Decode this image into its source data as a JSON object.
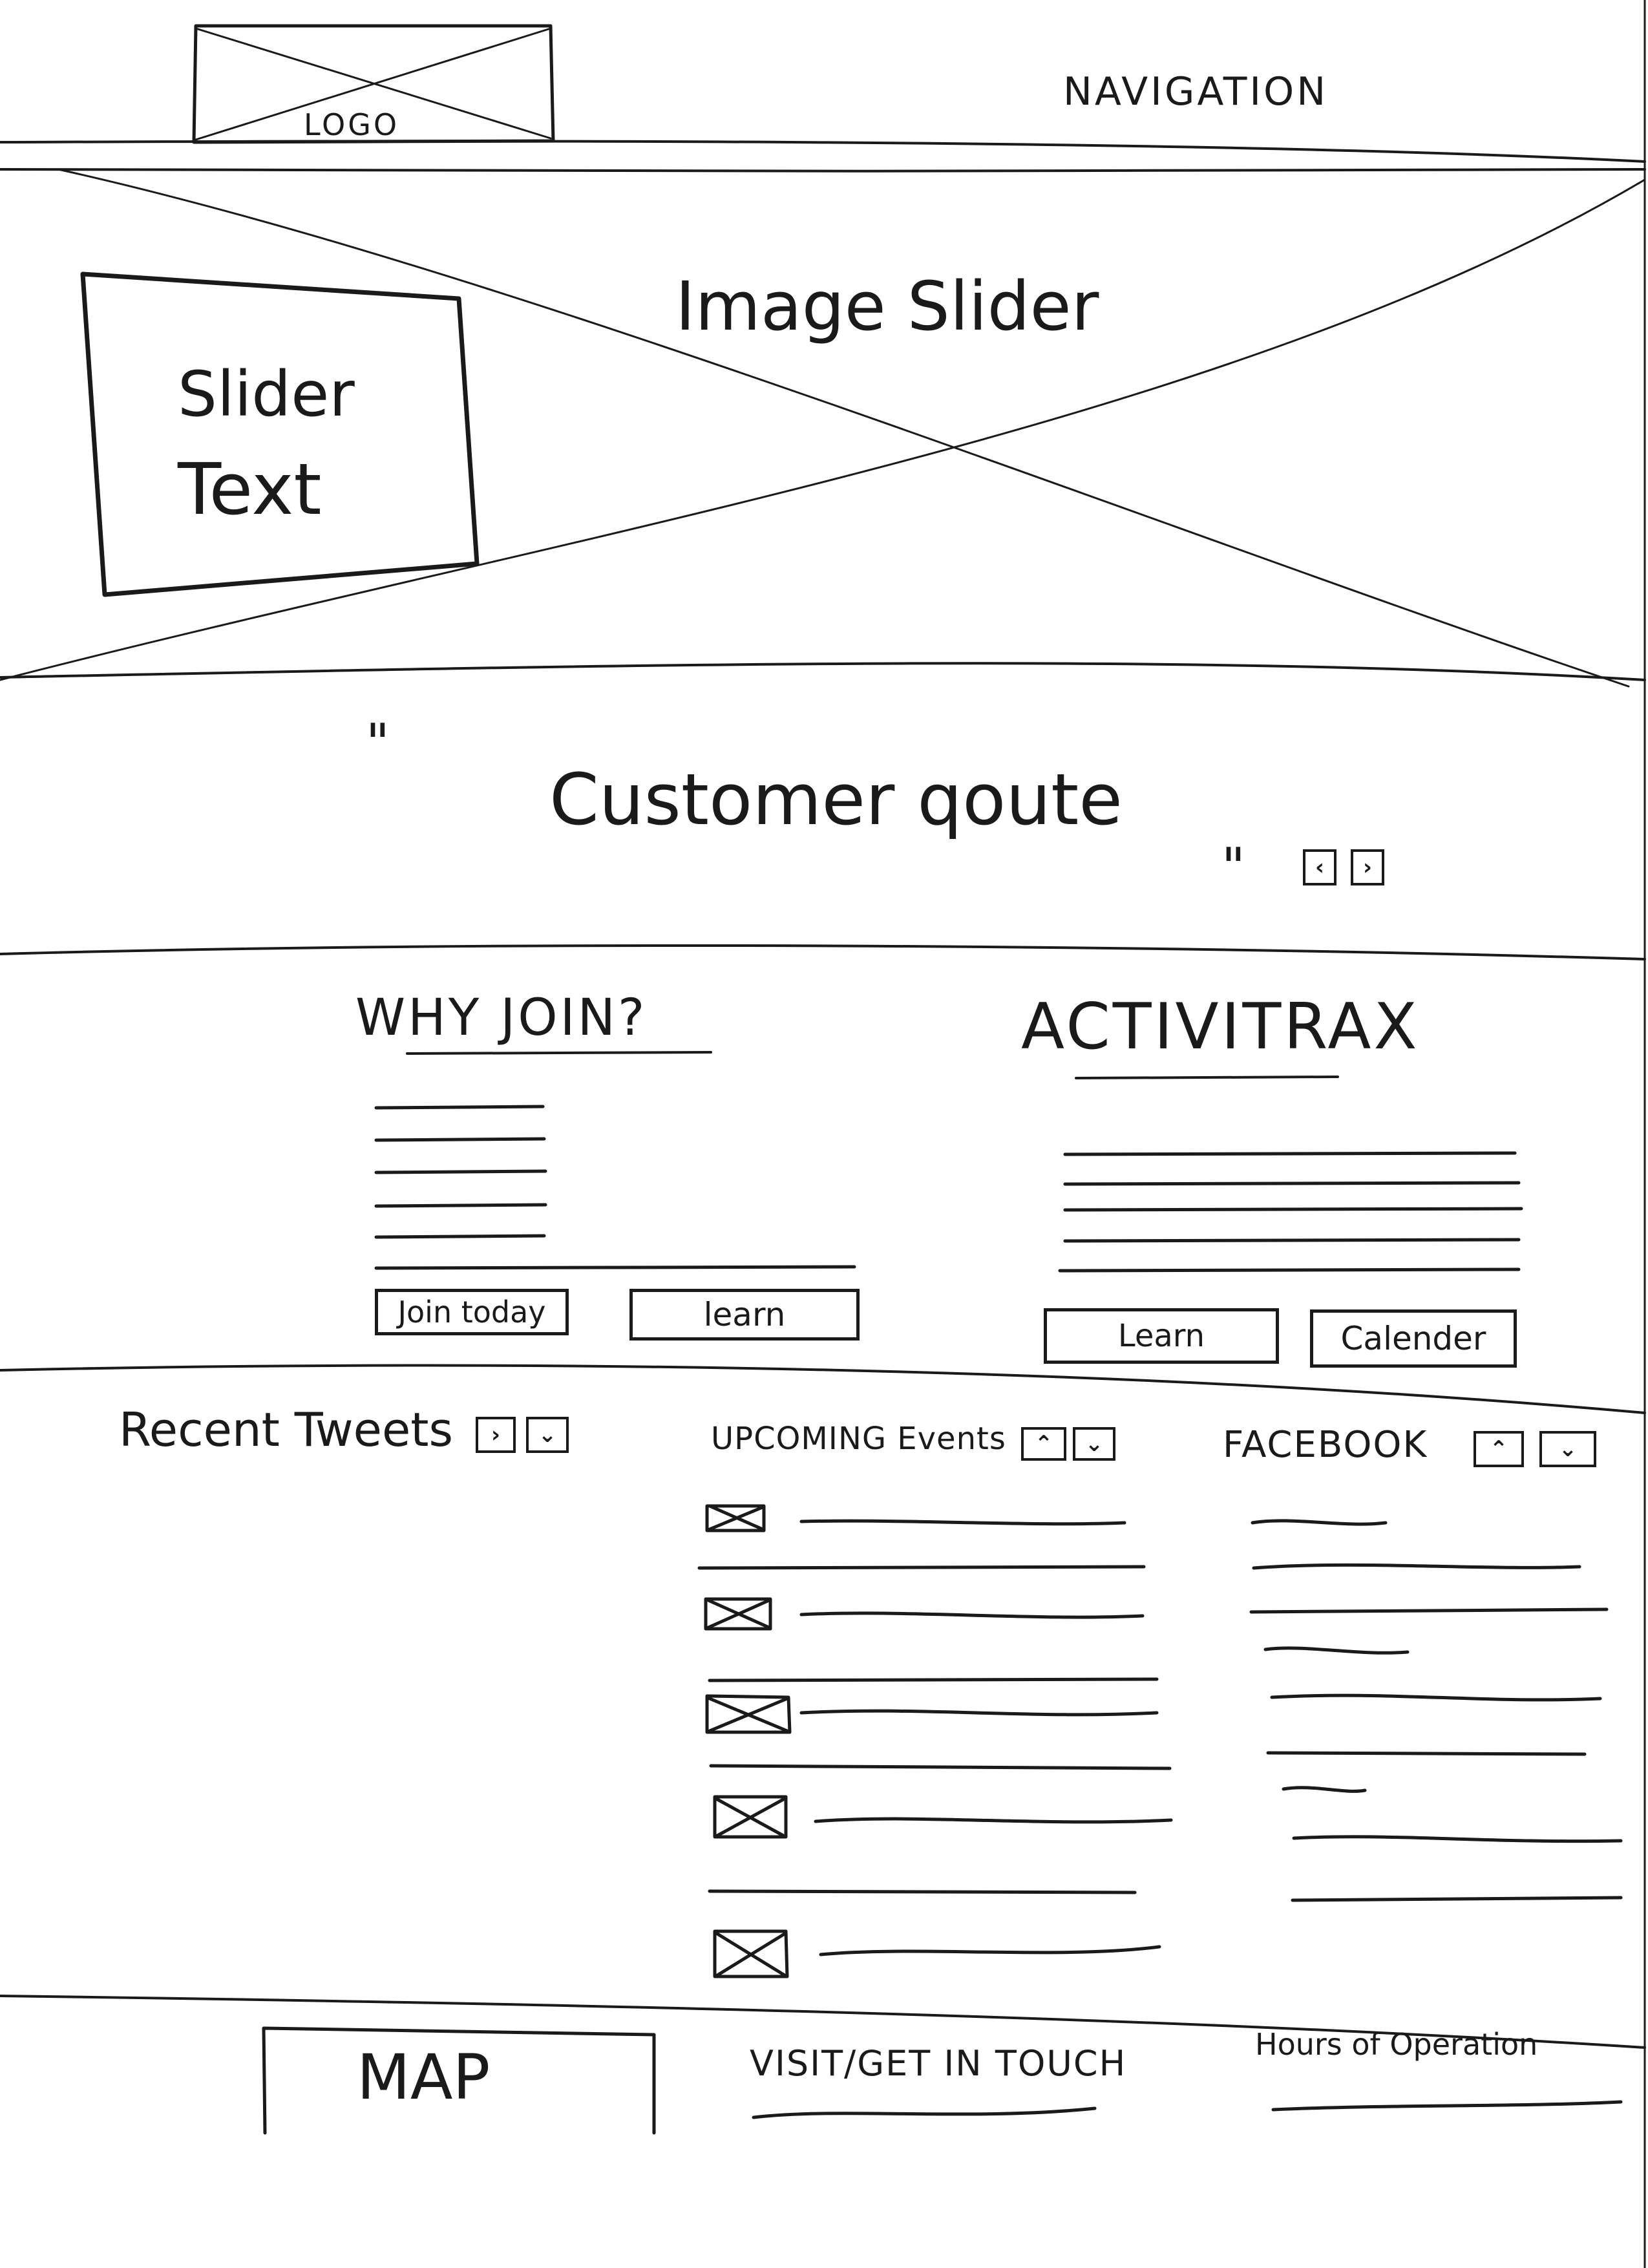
{
  "header": {
    "logo_label": "LOGO",
    "navigation_label": "NAVIGATION"
  },
  "slider": {
    "title": "Image Slider",
    "text_line1": "Slider",
    "text_line2": "Text"
  },
  "quote": {
    "open_mark": "\"",
    "close_mark": "\"",
    "text": "Customer qoute",
    "prev_icon": "chevron-left-icon",
    "next_icon": "chevron-right-icon"
  },
  "why_join": {
    "heading": "WHY JOIN?",
    "join_button": "Join today",
    "learn_button": "learn"
  },
  "activitrax": {
    "heading": "ACTIVITRAX",
    "learn_button": "Learn",
    "calendar_button": "Calender"
  },
  "tweets": {
    "heading": "Recent Tweets",
    "next_icon": "chevron-right-icon",
    "down_icon": "chevron-down-icon"
  },
  "events": {
    "heading": "UPCOMING Events",
    "up_icon": "chevron-up-icon",
    "down_icon": "chevron-down-icon"
  },
  "facebook": {
    "heading": "FACEBOOK",
    "up_icon": "chevron-up-icon",
    "down_icon": "chevron-down-icon"
  },
  "footer": {
    "map_label": "MAP",
    "visit_label": "VISIT/GET IN TOUCH",
    "hours_label": "Hours of Operation"
  }
}
